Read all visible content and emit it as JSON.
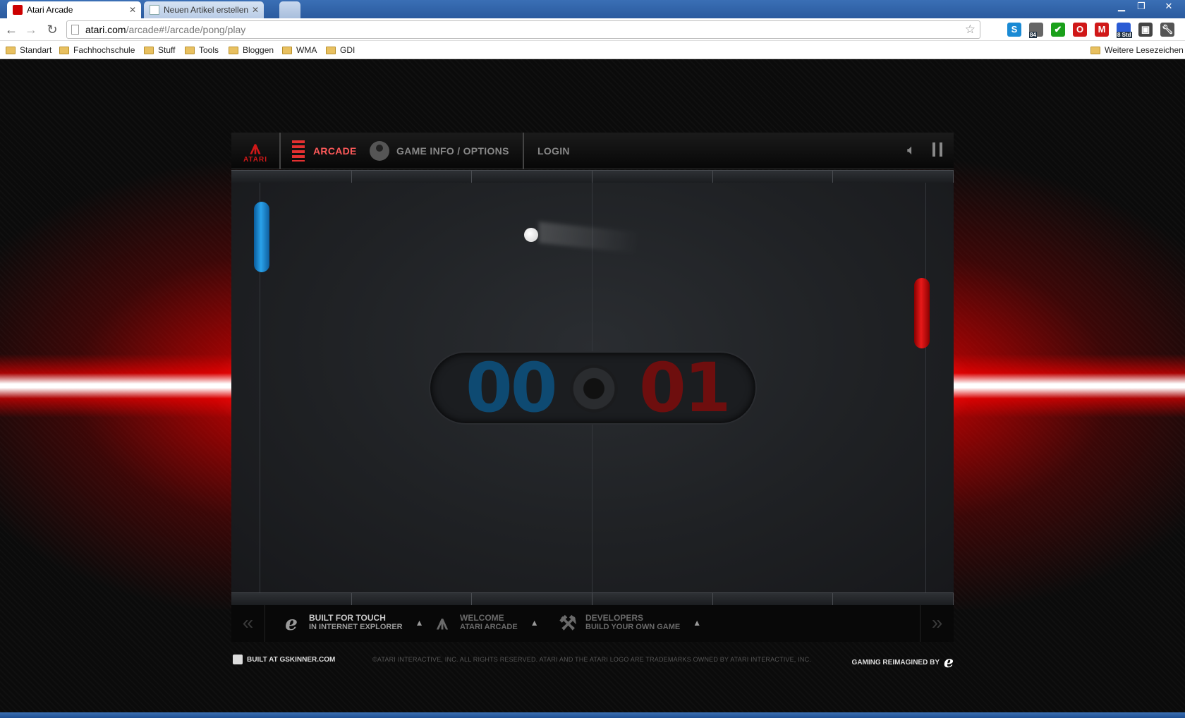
{
  "browser": {
    "tabs": [
      {
        "label": "Atari Arcade",
        "active": true
      },
      {
        "label": "Neuen Artikel erstellen ‹ Ti",
        "active": false
      }
    ],
    "url": {
      "host": "atari.com",
      "path": "/arcade#!/arcade/pong/play"
    },
    "extensions": [
      {
        "icon": "skype-icon",
        "color": "#1a8ad4",
        "badge": ""
      },
      {
        "icon": "counter-icon",
        "color": "#666666",
        "badge": "84"
      },
      {
        "icon": "checkmark-icon",
        "color": "#1aa01a",
        "badge": ""
      },
      {
        "icon": "opera-icon",
        "color": "#d01818",
        "badge": ""
      },
      {
        "icon": "gmail-icon",
        "color": "#d01818",
        "badge": ""
      },
      {
        "icon": "calendar-icon",
        "color": "#2a5bd4",
        "badge": "8 Std"
      },
      {
        "icon": "screenshot-icon",
        "color": "#444444",
        "badge": ""
      },
      {
        "icon": "wrench-icon",
        "color": "#555555",
        "badge": ""
      }
    ],
    "bookmarks": [
      "Standart",
      "Fachhochschule",
      "Stuff",
      "Tools",
      "Bloggen",
      "WMA",
      "GDI"
    ],
    "other_bookmarks": "Weitere Lesezeichen"
  },
  "game": {
    "nav": {
      "logo_text": "ATARI",
      "arcade": "ARCADE",
      "game_info": "GAME INFO / OPTIONS",
      "login": "LOGIN"
    },
    "score": {
      "blue": "00",
      "red": "01"
    },
    "promos": [
      {
        "title": "BUILT FOR TOUCH",
        "subtitle": "IN INTERNET EXPLORER",
        "icon": "ie-icon"
      },
      {
        "title": "WELCOME",
        "subtitle": "ATARI ARCADE",
        "icon": "atari-icon"
      },
      {
        "title": "DEVELOPERS",
        "subtitle": "BUILD YOUR OWN GAME",
        "icon": "hammer-icon"
      }
    ],
    "footer": {
      "built_at": "BUILT AT GSKINNER.COM",
      "copyright": "©ATARI INTERACTIVE, INC. ALL RIGHTS RESERVED. ATARI AND THE ATARI LOGO ARE TRADEMARKS OWNED BY ATARI INTERACTIVE, INC.",
      "gaming": "GAMING REIMAGINED BY"
    }
  }
}
